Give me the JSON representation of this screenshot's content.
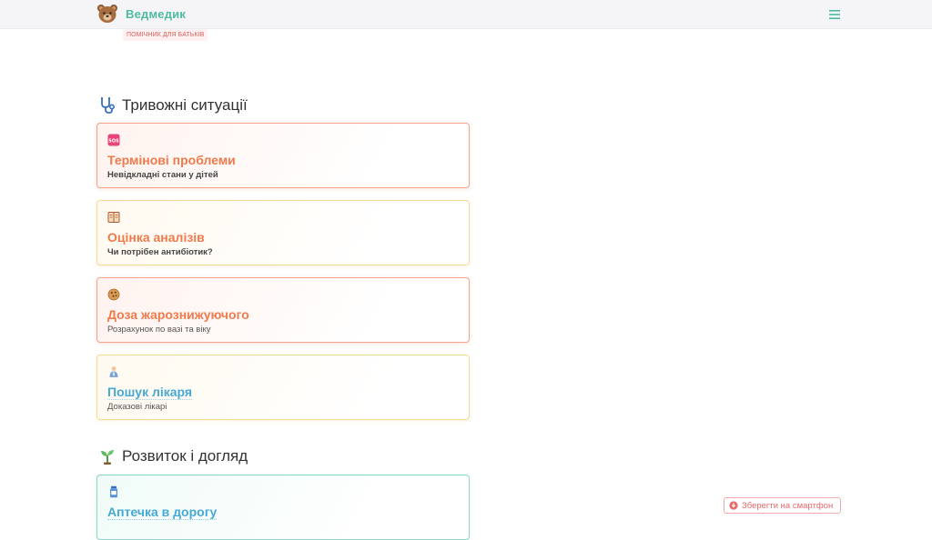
{
  "header": {
    "brand": "Ведмедик",
    "tagline": "ПОМІЧНИК ДЛЯ БАТЬКІВ",
    "logo_icon": "bear-icon",
    "menu_icon": "hamburger-icon"
  },
  "colors": {
    "brand": "#4fbaa2",
    "accent_orange": "#ef7b4c",
    "accent_blue": "#46a9d4",
    "alert_red": "#e66a6a"
  },
  "sections": [
    {
      "title": "Тривожні ситуації",
      "icon": "stethoscope-icon",
      "cards": [
        {
          "icon": "sos-icon",
          "title": "Термінові проблеми",
          "subtitle": "Невідкладні стани у дітей"
        },
        {
          "icon": "notebook-icon",
          "title": "Оцінка аналізів",
          "subtitle": "Чи потрібен антибіотик?"
        },
        {
          "icon": "cookie-icon",
          "title": "Доза жарознижуючого",
          "subtitle": "Розрахунок по вазі та віку"
        },
        {
          "icon": "doctor-icon",
          "title": "Пошук лікаря",
          "subtitle": "Доказові лікарі"
        }
      ]
    },
    {
      "title": "Розвиток і догляд",
      "icon": "seedling-icon",
      "cards": [
        {
          "icon": "medicine-bottle-icon",
          "title": "Аптечка в дорогу",
          "subtitle": ""
        }
      ]
    }
  ],
  "save_button": {
    "label": "Зберегти на смартфон",
    "icon": "download-icon"
  }
}
